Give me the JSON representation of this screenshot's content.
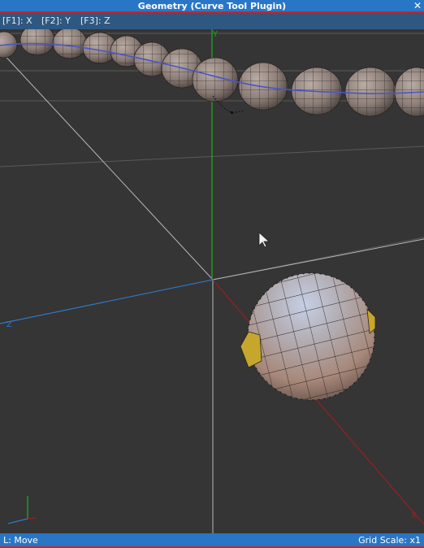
{
  "window": {
    "title": "Geometry (Curve Tool Plugin)"
  },
  "axis_toggles": [
    "[F1]: X",
    "[F2]: Y",
    "[F3]: Z"
  ],
  "viewport": {
    "axis_labels": {
      "y": "Y",
      "z": "Z",
      "x": "X"
    }
  },
  "status": {
    "left": "L: Move",
    "right": "Grid Scale: x1"
  }
}
